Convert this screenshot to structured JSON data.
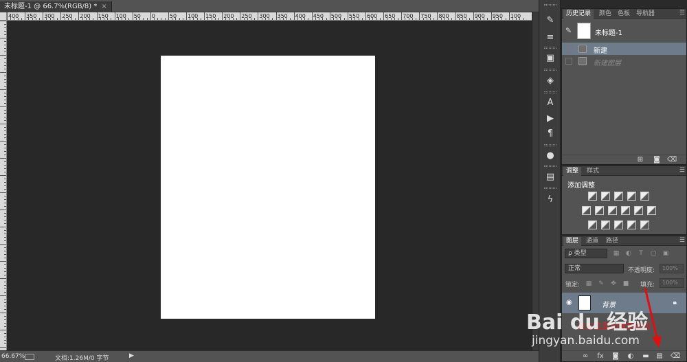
{
  "document": {
    "tab_title": "未标题-1 @ 66.7%(RGB/8) *",
    "close_glyph": "×",
    "ruler_numbers": [
      "400",
      "350",
      "300",
      "250",
      "200",
      "150",
      "100",
      "50",
      "0",
      "50",
      "100",
      "150",
      "200",
      "250",
      "300",
      "350",
      "400",
      "450",
      "500",
      "550",
      "600",
      "650",
      "700",
      "750",
      "800",
      "850",
      "900",
      "950",
      "100"
    ]
  },
  "status": {
    "zoom": "66.67%",
    "doc_info": "文档:1.26M/0 字节",
    "arrow": "▶"
  },
  "tools": {
    "icons": [
      "history-brush-icon",
      "sliders-icon",
      "brush-presets-icon",
      "3d-cube-icon",
      "character-icon",
      "play-icon",
      "paragraph-icon",
      "kuler-icon",
      "image-icon",
      "lightning-icon"
    ]
  },
  "history_panel": {
    "tabs": [
      "历史记录",
      "颜色",
      "色板",
      "导航器"
    ],
    "snapshot_name": "未标题-1",
    "rows": [
      {
        "label": "新建"
      },
      {
        "label": "新建图层"
      }
    ]
  },
  "adjust_panel": {
    "tabs": [
      "调整",
      "样式"
    ],
    "title": "添加调整"
  },
  "layers_panel": {
    "tabs": [
      "图层",
      "通道",
      "路径"
    ],
    "filter_label": "ρ 类型",
    "blend_mode": "正常",
    "opacity_label": "不透明度:",
    "opacity_value": "100%",
    "lock_label": "锁定:",
    "fill_label": "填充:",
    "fill_value": "100%",
    "layer_name": "背景",
    "footer_icons": [
      "link-icon",
      "fx-icon",
      "mask-icon",
      "adjustment-icon",
      "folder-icon",
      "new-layer-icon",
      "trash-icon"
    ]
  },
  "overlay": {
    "annotation": "点击这里创建新图层",
    "watermark_logo": "Bai du 经验",
    "watermark_url": "jingyan.baidu.com"
  }
}
